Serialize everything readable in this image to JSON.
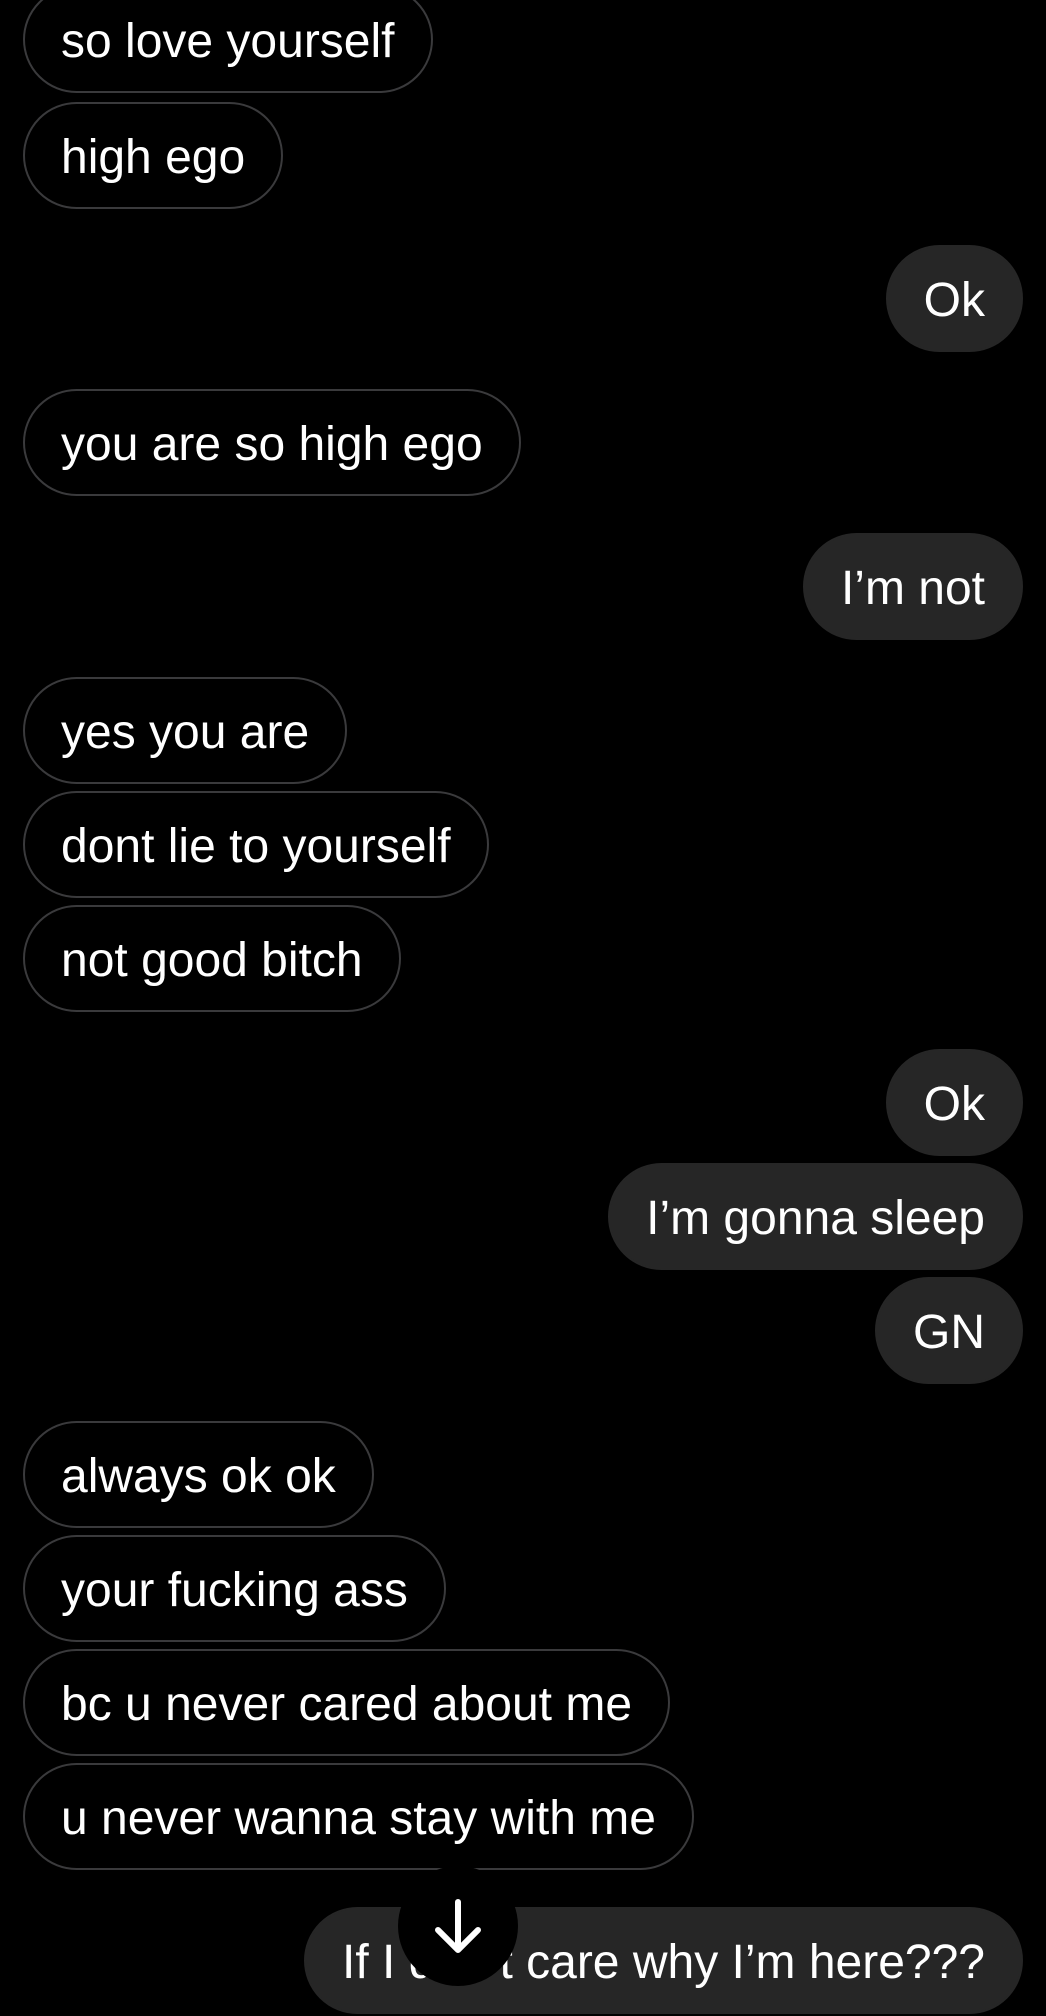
{
  "colors": {
    "background": "#000000",
    "incoming_border": "#3a3a3c",
    "outgoing_fill": "#262626",
    "text": "#ffffff"
  },
  "scroll_button": {
    "icon": "arrow-down-icon"
  },
  "messages": [
    {
      "direction": "incoming",
      "text": "so love yourself"
    },
    {
      "direction": "incoming",
      "text": "high ego"
    },
    {
      "direction": "outgoing",
      "text": "Ok"
    },
    {
      "direction": "incoming",
      "text": "you are so high ego"
    },
    {
      "direction": "outgoing",
      "text": "I’m not"
    },
    {
      "direction": "incoming",
      "text": "yes you are"
    },
    {
      "direction": "incoming",
      "text": "dont lie to yourself"
    },
    {
      "direction": "incoming",
      "text": "not good bitch"
    },
    {
      "direction": "outgoing",
      "text": "Ok"
    },
    {
      "direction": "outgoing",
      "text": "I’m gonna sleep"
    },
    {
      "direction": "outgoing",
      "text": "GN"
    },
    {
      "direction": "incoming",
      "text": "always ok ok"
    },
    {
      "direction": "incoming",
      "text": "your fucking ass"
    },
    {
      "direction": "incoming",
      "text": "bc u never cared about me"
    },
    {
      "direction": "incoming",
      "text": "u never wanna stay with me"
    },
    {
      "direction": "outgoing",
      "text": "If I don’t care why I’m here???"
    }
  ]
}
